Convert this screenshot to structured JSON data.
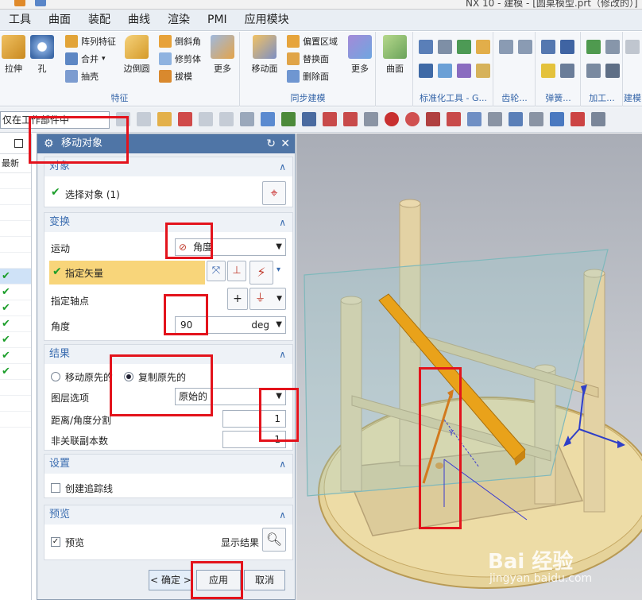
{
  "window": {
    "title_fragment": "NX 10 - 建模 - [圆桌模型.prt（修改的）]"
  },
  "menu": [
    "工具",
    "曲面",
    "装配",
    "曲线",
    "渲染",
    "PMI",
    "应用模块"
  ],
  "ribbon": {
    "features": {
      "label": "特征",
      "pull": "拉伸",
      "hole": "孔",
      "pattern": "阵列特征",
      "unite": "合并",
      "shell": "抽壳",
      "edge_blend": "边倒圆",
      "chamfer": "倒斜角",
      "trim_body": "修剪体",
      "draft": "拔模",
      "more": "更多"
    },
    "sync": {
      "label": "同步建模",
      "move_face": "移动面",
      "offset_region": "偏置区域",
      "replace_face": "替换面",
      "delete_face": "删除面",
      "more": "更多"
    },
    "surface": {
      "curve": "曲面"
    },
    "group_labels": [
      "标准化工具 - G...",
      "齿轮...",
      "弹簧...",
      "加工...",
      "建模"
    ]
  },
  "toolbar": {
    "filter_value": "仅在工作部件中"
  },
  "leftnav": {
    "column_label": "最新"
  },
  "dialog": {
    "title": "移动对象",
    "object_section": {
      "title": "对象",
      "select_label": "选择对象 (1)"
    },
    "transform_section": {
      "title": "变换",
      "motion_label": "运动",
      "motion_value": "角度",
      "vector_label": "指定矢量",
      "axis_point_label": "指定轴点",
      "angle_label": "角度",
      "angle_value": "90",
      "angle_unit": "deg"
    },
    "result_section": {
      "title": "结果",
      "move_original": "移动原先的",
      "copy_original": "复制原先的",
      "layer_label": "图层选项",
      "layer_value": "原始的",
      "distance_label": "距离/角度分割",
      "distance_value": "1",
      "copies_label": "非关联副本数",
      "copies_value": "1"
    },
    "settings_section": {
      "title": "设置",
      "trace_label": "创建追踪线"
    },
    "preview_section": {
      "title": "预览",
      "preview_label": "预览",
      "show_result_label": "显示结果"
    },
    "buttons": {
      "ok": "< 确定 >",
      "apply": "应用",
      "cancel": "取消"
    }
  },
  "watermark": {
    "brand": "Bai 经验",
    "url": "jingyan.baidu.com"
  },
  "colors": {
    "annotation_red": "#e3131c",
    "dialog_title": "#4f75a6",
    "vector_highlight": "#f8d57a",
    "selected_bar": "#e9a21a"
  }
}
